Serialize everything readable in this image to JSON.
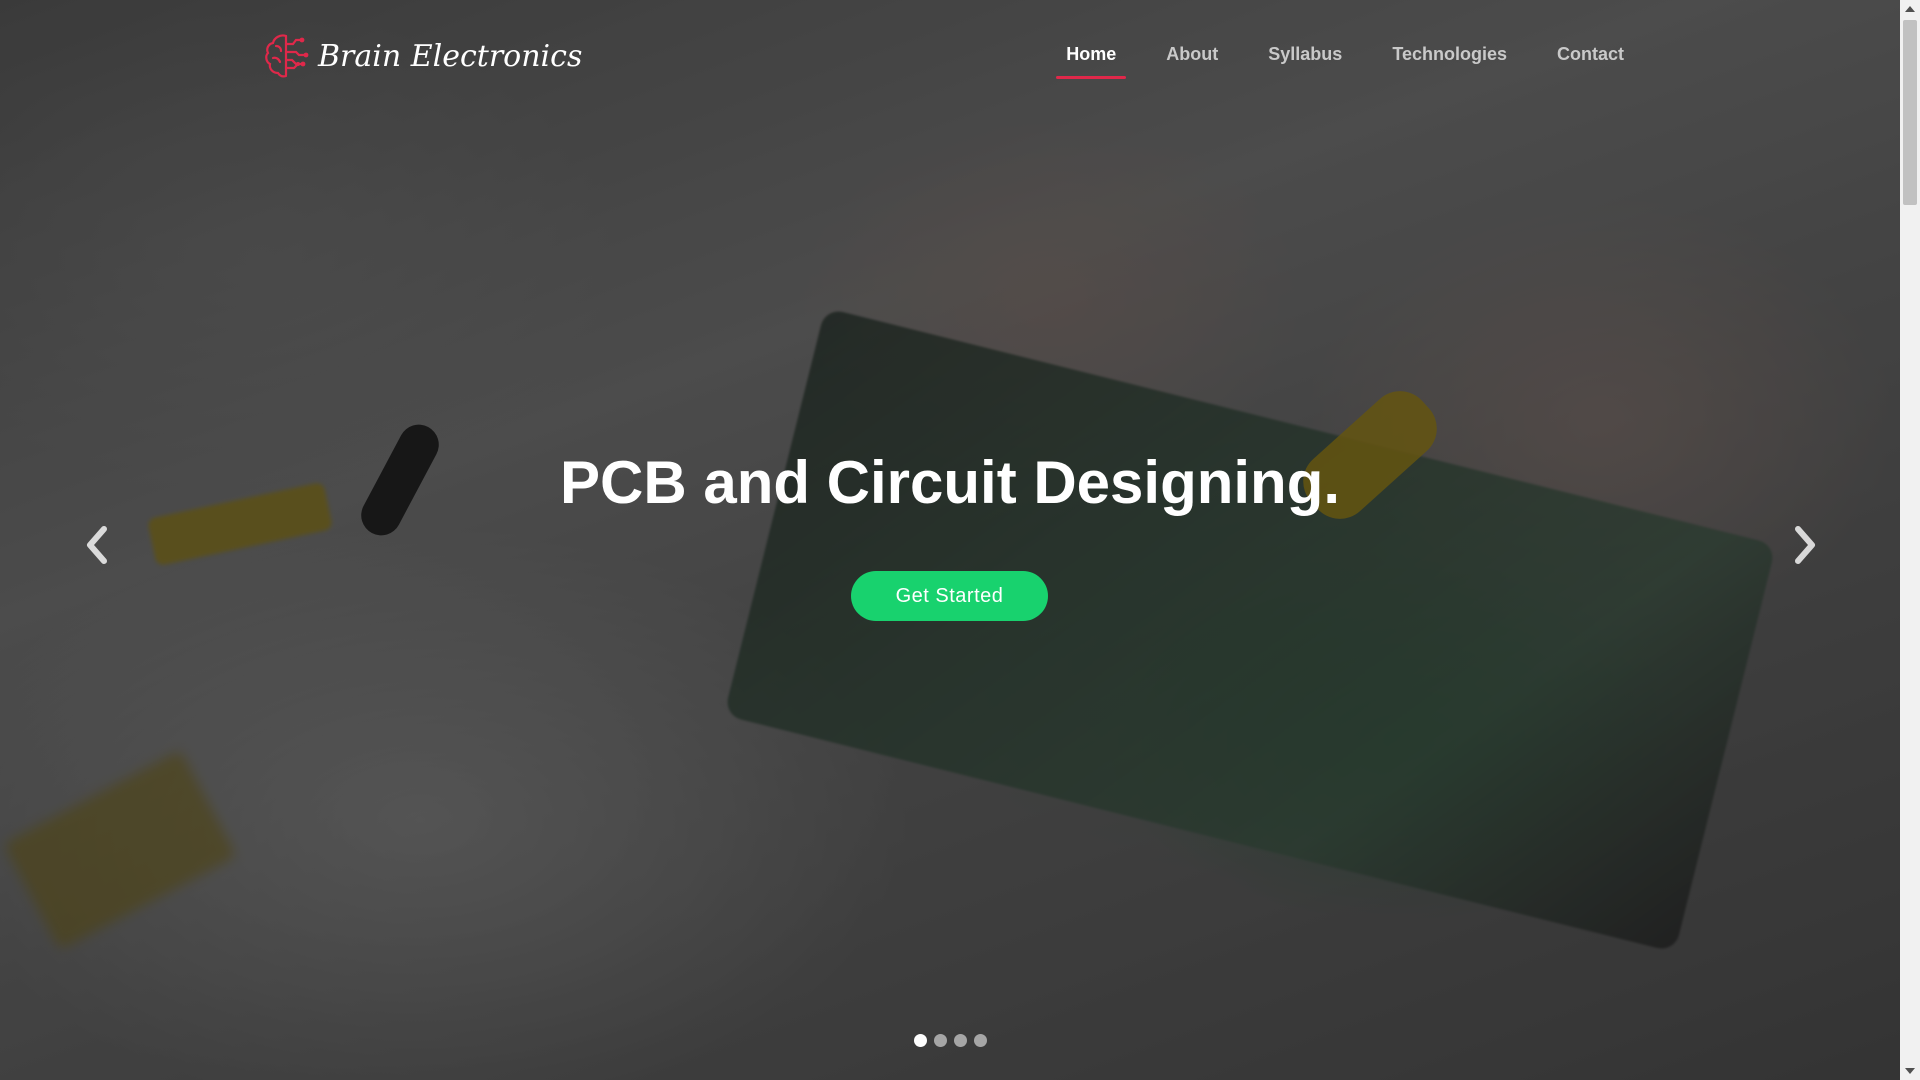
{
  "brand": {
    "name": "Brain Electronics",
    "icon": "brain-circuit-icon",
    "icon_color": "#e0284a"
  },
  "nav": {
    "items": [
      {
        "label": "Home",
        "active": true
      },
      {
        "label": "About",
        "active": false
      },
      {
        "label": "Syllabus",
        "active": false
      },
      {
        "label": "Technologies",
        "active": false
      },
      {
        "label": "Contact",
        "active": false
      }
    ],
    "active_underline_color": "#e0284a"
  },
  "hero": {
    "title": "PCB and Circuit Designing.",
    "cta_label": "Get Started",
    "cta_color": "#18d26e",
    "prev_icon": "chevron-left-icon",
    "next_icon": "chevron-right-icon",
    "slides_count": 4,
    "active_slide": 1
  },
  "scrollbar": {
    "up_icon": "scroll-up-icon",
    "down_icon": "scroll-down-icon"
  }
}
